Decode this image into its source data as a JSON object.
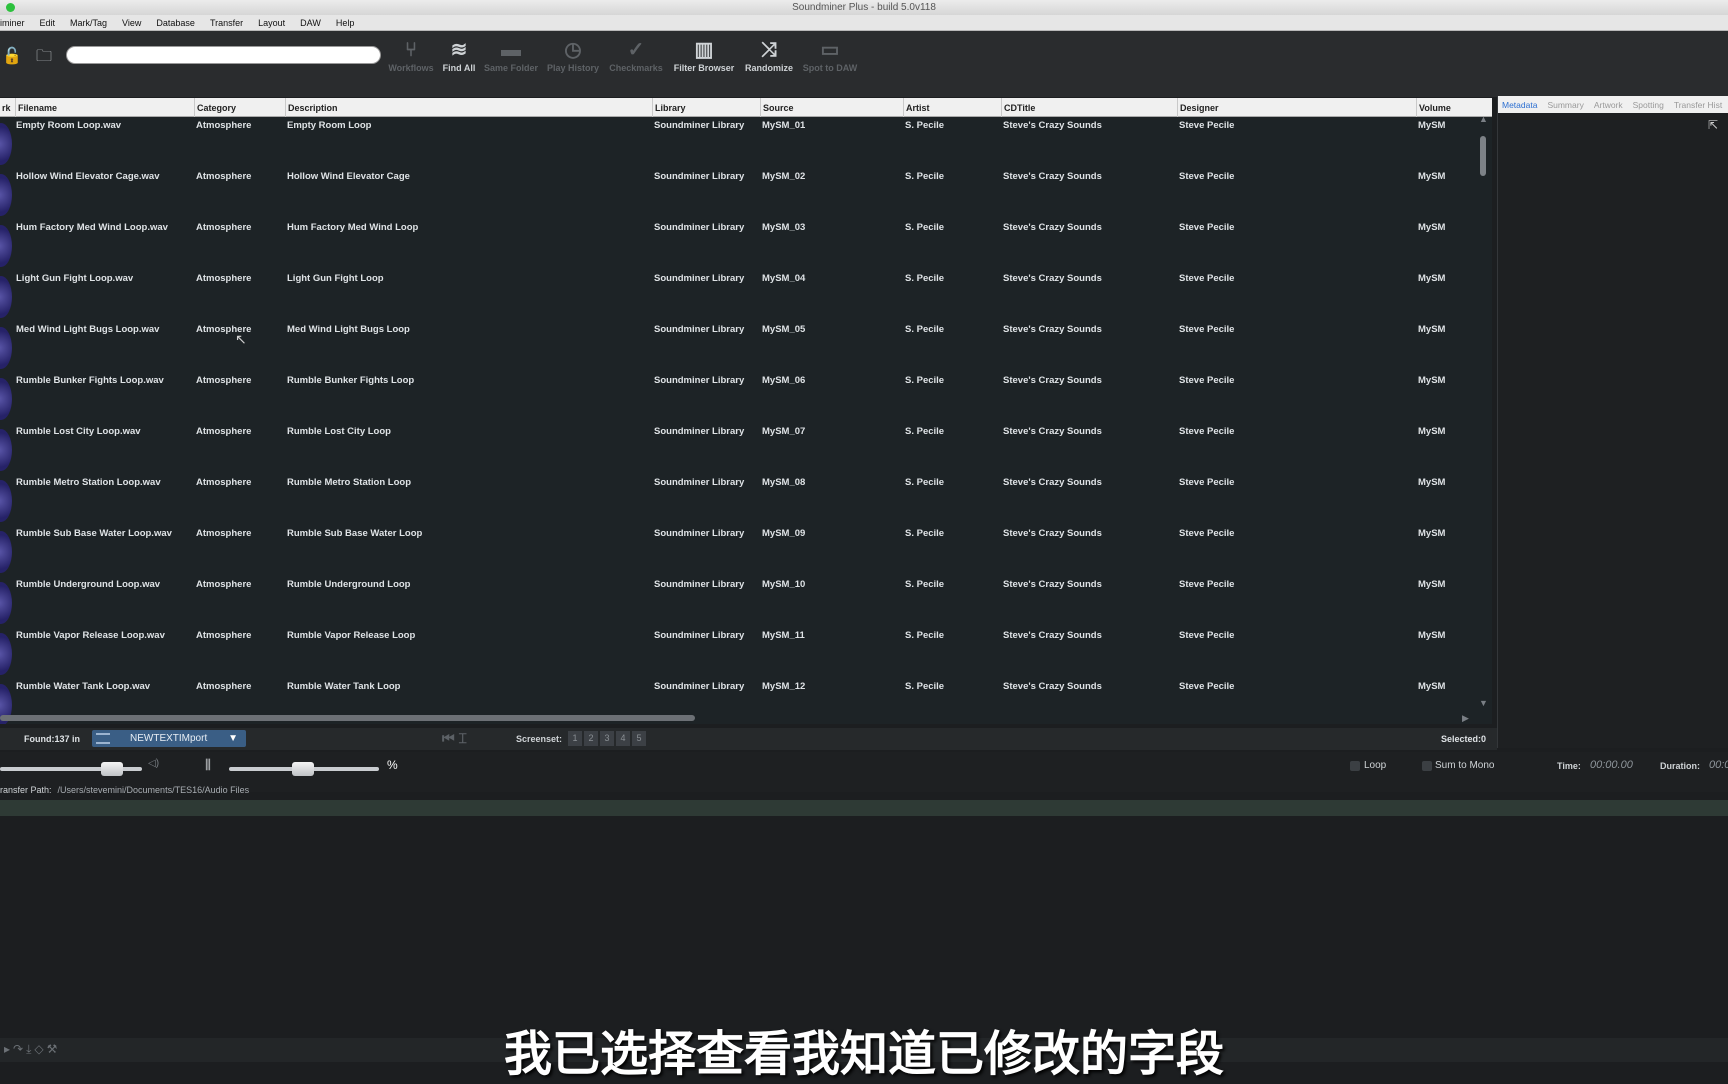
{
  "window": {
    "title": "Soundminer Plus - build 5.0v118"
  },
  "menu": [
    "iminer",
    "Edit",
    "Mark/Tag",
    "View",
    "Database",
    "Transfer",
    "Layout",
    "DAW",
    "Help"
  ],
  "toolbar": {
    "search_value": "",
    "tools": [
      {
        "label": "Workflows",
        "icon": "workflows-icon",
        "enabled": false
      },
      {
        "label": "Find All",
        "icon": "find-all-icon",
        "enabled": true
      },
      {
        "label": "Same Folder",
        "icon": "folder-icon",
        "enabled": false
      },
      {
        "label": "Play History",
        "icon": "history-icon",
        "enabled": false
      },
      {
        "label": "Checkmarks",
        "icon": "checkmark-icon",
        "enabled": false
      },
      {
        "label": "Filter Browser",
        "icon": "columns-icon",
        "enabled": true
      },
      {
        "label": "Randomize",
        "icon": "shuffle-icon",
        "enabled": true
      },
      {
        "label": "Spot to DAW",
        "icon": "monitor-icon",
        "enabled": false
      }
    ]
  },
  "grid": {
    "columns": [
      "rk",
      "Filename",
      "Category",
      "Description",
      "Library",
      "Source",
      "Artist",
      "CDTitle",
      "Designer",
      "Volume"
    ],
    "rows": [
      {
        "filename": "Empty Room Loop.wav",
        "category": "Atmosphere",
        "description": "Empty Room Loop",
        "library": "Soundminer Library",
        "source": "MySM_01",
        "artist": "S. Pecile",
        "cdtitle": "Steve's Crazy Sounds",
        "designer": "Steve Pecile",
        "volume": "MySM"
      },
      {
        "filename": "Hollow Wind Elevator Cage.wav",
        "category": "Atmosphere",
        "description": "Hollow Wind Elevator Cage",
        "library": "Soundminer Library",
        "source": "MySM_02",
        "artist": "S. Pecile",
        "cdtitle": "Steve's Crazy Sounds",
        "designer": "Steve Pecile",
        "volume": "MySM"
      },
      {
        "filename": "Hum Factory Med Wind Loop.wav",
        "category": "Atmosphere",
        "description": "Hum Factory Med Wind Loop",
        "library": "Soundminer Library",
        "source": "MySM_03",
        "artist": "S. Pecile",
        "cdtitle": "Steve's Crazy Sounds",
        "designer": "Steve Pecile",
        "volume": "MySM"
      },
      {
        "filename": "Light Gun Fight Loop.wav",
        "category": "Atmosphere",
        "description": "Light Gun Fight Loop",
        "library": "Soundminer Library",
        "source": "MySM_04",
        "artist": "S. Pecile",
        "cdtitle": "Steve's Crazy Sounds",
        "designer": "Steve Pecile",
        "volume": "MySM"
      },
      {
        "filename": "Med Wind Light Bugs Loop.wav",
        "category": "Atmosphere",
        "description": "Med Wind Light Bugs Loop",
        "library": "Soundminer Library",
        "source": "MySM_05",
        "artist": "S. Pecile",
        "cdtitle": "Steve's Crazy Sounds",
        "designer": "Steve Pecile",
        "volume": "MySM"
      },
      {
        "filename": "Rumble Bunker Fights Loop.wav",
        "category": "Atmosphere",
        "description": "Rumble Bunker Fights Loop",
        "library": "Soundminer Library",
        "source": "MySM_06",
        "artist": "S. Pecile",
        "cdtitle": "Steve's Crazy Sounds",
        "designer": "Steve Pecile",
        "volume": "MySM"
      },
      {
        "filename": "Rumble Lost City Loop.wav",
        "category": "Atmosphere",
        "description": "Rumble Lost City Loop",
        "library": "Soundminer Library",
        "source": "MySM_07",
        "artist": "S. Pecile",
        "cdtitle": "Steve's Crazy Sounds",
        "designer": "Steve Pecile",
        "volume": "MySM"
      },
      {
        "filename": "Rumble Metro Station Loop.wav",
        "category": "Atmosphere",
        "description": "Rumble Metro Station Loop",
        "library": "Soundminer Library",
        "source": "MySM_08",
        "artist": "S. Pecile",
        "cdtitle": "Steve's Crazy Sounds",
        "designer": "Steve Pecile",
        "volume": "MySM"
      },
      {
        "filename": "Rumble Sub Base Water Loop.wav",
        "category": "Atmosphere",
        "description": "Rumble Sub Base Water Loop",
        "library": "Soundminer Library",
        "source": "MySM_09",
        "artist": "S. Pecile",
        "cdtitle": "Steve's Crazy Sounds",
        "designer": "Steve Pecile",
        "volume": "MySM"
      },
      {
        "filename": "Rumble Underground Loop.wav",
        "category": "Atmosphere",
        "description": "Rumble Underground Loop",
        "library": "Soundminer Library",
        "source": "MySM_10",
        "artist": "S. Pecile",
        "cdtitle": "Steve's Crazy Sounds",
        "designer": "Steve Pecile",
        "volume": "MySM"
      },
      {
        "filename": "Rumble Vapor Release Loop.wav",
        "category": "Atmosphere",
        "description": "Rumble Vapor Release Loop",
        "library": "Soundminer Library",
        "source": "MySM_11",
        "artist": "S. Pecile",
        "cdtitle": "Steve's Crazy Sounds",
        "designer": "Steve Pecile",
        "volume": "MySM"
      },
      {
        "filename": "Rumble Water Tank Loop.wav",
        "category": "Atmosphere",
        "description": "Rumble Water Tank Loop",
        "library": "Soundminer Library",
        "source": "MySM_12",
        "artist": "S. Pecile",
        "cdtitle": "Steve's Crazy Sounds",
        "designer": "Steve Pecile",
        "volume": "MySM"
      }
    ]
  },
  "side_panel": {
    "tabs": [
      "Metadata",
      "Summary",
      "Artwork",
      "Spotting",
      "Transfer Hist"
    ],
    "active": "Metadata"
  },
  "status": {
    "found": "Found:137 in",
    "database": "NEWTEXTIMport",
    "screenset_label": "Screenset:",
    "screensets": [
      "1",
      "2",
      "3",
      "4",
      "5"
    ],
    "selected": "Selected:0"
  },
  "transport": {
    "volume_percent_label": "%",
    "loop_label": "Loop",
    "sum_to_mono_label": "Sum to Mono",
    "time_label": "Time:",
    "time_value": "00:00.00",
    "duration_label": "Duration:",
    "duration_value": "00:0"
  },
  "transfer": {
    "label": "ransfer Path:",
    "path": "/Users/stevemini/Documents/TES16/Audio Files"
  },
  "subtitle": "我已选择查看我知道已修改的字段",
  "colors": {
    "accent": "#3a5e85",
    "link_tab": "#2c6fd1"
  }
}
